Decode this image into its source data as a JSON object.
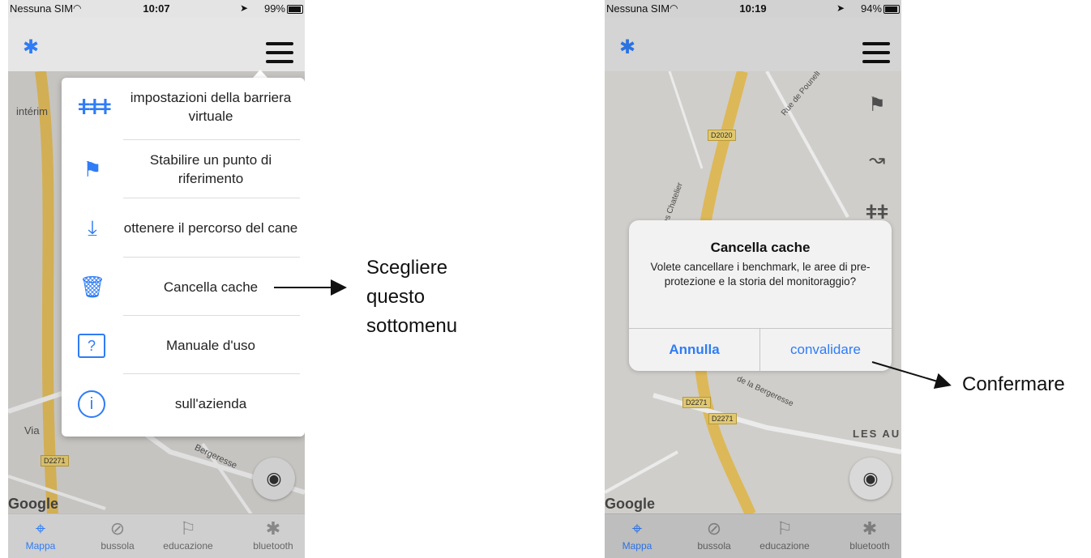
{
  "phoneA": {
    "status": {
      "carrier": "Nessuna SIM",
      "time": "10:07",
      "battery": "99%"
    },
    "map_labels": {
      "interim": "intérim",
      "via": "Via",
      "road": "D2271",
      "street": "Bergeresse",
      "google": "Google"
    },
    "menu": [
      {
        "icon": "fence-icon",
        "glyph": "ǂ",
        "label": "impostazioni della barriera virtuale"
      },
      {
        "icon": "flag-icon",
        "glyph": "⚑",
        "label": "Stabilire un punto di riferimento"
      },
      {
        "icon": "download-icon",
        "glyph": "⤓",
        "label": "ottenere il percorso del cane"
      },
      {
        "icon": "trash-icon",
        "glyph": "🗑",
        "label": "Cancella cache"
      },
      {
        "icon": "manual-icon",
        "glyph": "?",
        "label": "Manuale d'uso"
      },
      {
        "icon": "info-icon",
        "glyph": "i",
        "label": "sull'azienda"
      }
    ]
  },
  "phoneB": {
    "status": {
      "carrier": "Nessuna SIM",
      "time": "10:19",
      "battery": "94%"
    },
    "map_labels": {
      "road1": "D2020",
      "road2": "D2271",
      "road3": "D2271",
      "les": "LES AU",
      "google": "Google",
      "rue1": "Rue de Pounell",
      "rue2": "Rue des Chatelier",
      "street": "de la Bergeresse"
    },
    "alert": {
      "title": "Cancella cache",
      "message": "Volete cancellare i benchmark, le aree di pre-protezione e la storia del monitoraggio?",
      "cancel": "Annulla",
      "confirm": "convalidare"
    }
  },
  "tabs": [
    "Mappa",
    "bussola",
    "educazione",
    "bluetooth"
  ],
  "annotations": {
    "a_line1": "Scegliere",
    "a_line2": "questo",
    "a_line3": "sottomenu",
    "b": "Confermare"
  },
  "colors": {
    "accent": "#2f7cf6"
  }
}
